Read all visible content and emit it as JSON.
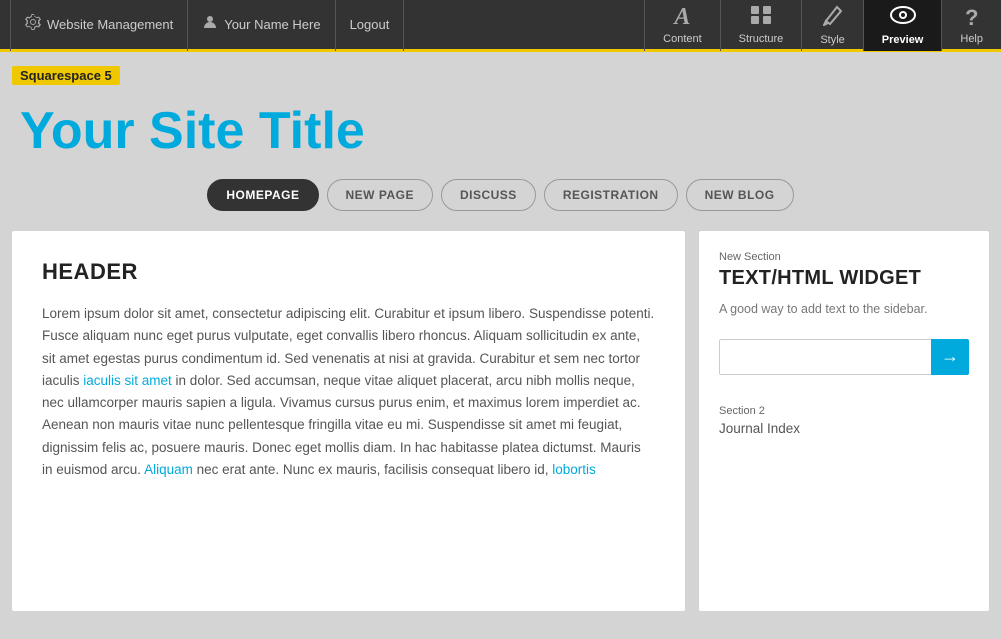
{
  "topbar": {
    "website_management_label": "Website Management",
    "user_name": "Your Name Here",
    "logout_label": "Logout",
    "nav_items": [
      {
        "id": "content",
        "icon": "A",
        "label": "Content"
      },
      {
        "id": "structure",
        "icon": "grid",
        "label": "Structure"
      },
      {
        "id": "style",
        "icon": "pen",
        "label": "Style"
      },
      {
        "id": "preview",
        "icon": "eye",
        "label": "Preview",
        "active": true
      },
      {
        "id": "help",
        "icon": "?",
        "label": "Help"
      }
    ]
  },
  "badge": {
    "text": "Squarespace 5"
  },
  "site_title": "Your Site Title",
  "nav_tabs": [
    {
      "id": "homepage",
      "label": "HOMEPAGE",
      "active": true
    },
    {
      "id": "new-page",
      "label": "NEW PAGE",
      "active": false
    },
    {
      "id": "discuss",
      "label": "DISCUSS",
      "active": false
    },
    {
      "id": "registration",
      "label": "REGISTRATION",
      "active": false
    },
    {
      "id": "new-blog",
      "label": "NEW BLOG",
      "active": false
    }
  ],
  "main_content": {
    "header": "HEADER",
    "body_text": "Lorem ipsum dolor sit amet, consectetur adipiscing elit. Curabitur et ipsum libero. Suspendisse potenti. Fusce aliquam nunc eget purus vulputate, eget convallis libero rhoncus. Aliquam sollicitudin ex ante, sit amet egestas purus condimentum id. Sed venenatis at nisi at gravida. Curabitur et sem nec tortor iaculis iaculis sit amet in dolor. Sed accumsan, neque vitae aliquet placerat, arcu nibh mollis neque, nec ullamcorper mauris sapien a ligula. Vivamus cursus purus enim, et maximus lorem imperdiet ac. Aenean non mauris vitae nunc pellentesque fringilla vitae eu mi. Suspendisse sit amet mi feugiat, dignissim felis ac, posuere mauris. Donec eget mollis diam. In hac habitasse platea dictumst. Mauris in euismod arcu. Aliquam nec erat ante. Nunc ex mauris, facilisis consequat libero id, lobortis"
  },
  "sidebar": {
    "section1_label": "New Section",
    "widget_title": "TEXT/HTML WIDGET",
    "widget_desc": "A good way to add text to the sidebar.",
    "input_placeholder": "",
    "input_btn_icon": "→",
    "section2_label": "Section 2",
    "section2_value": "Journal Index"
  }
}
